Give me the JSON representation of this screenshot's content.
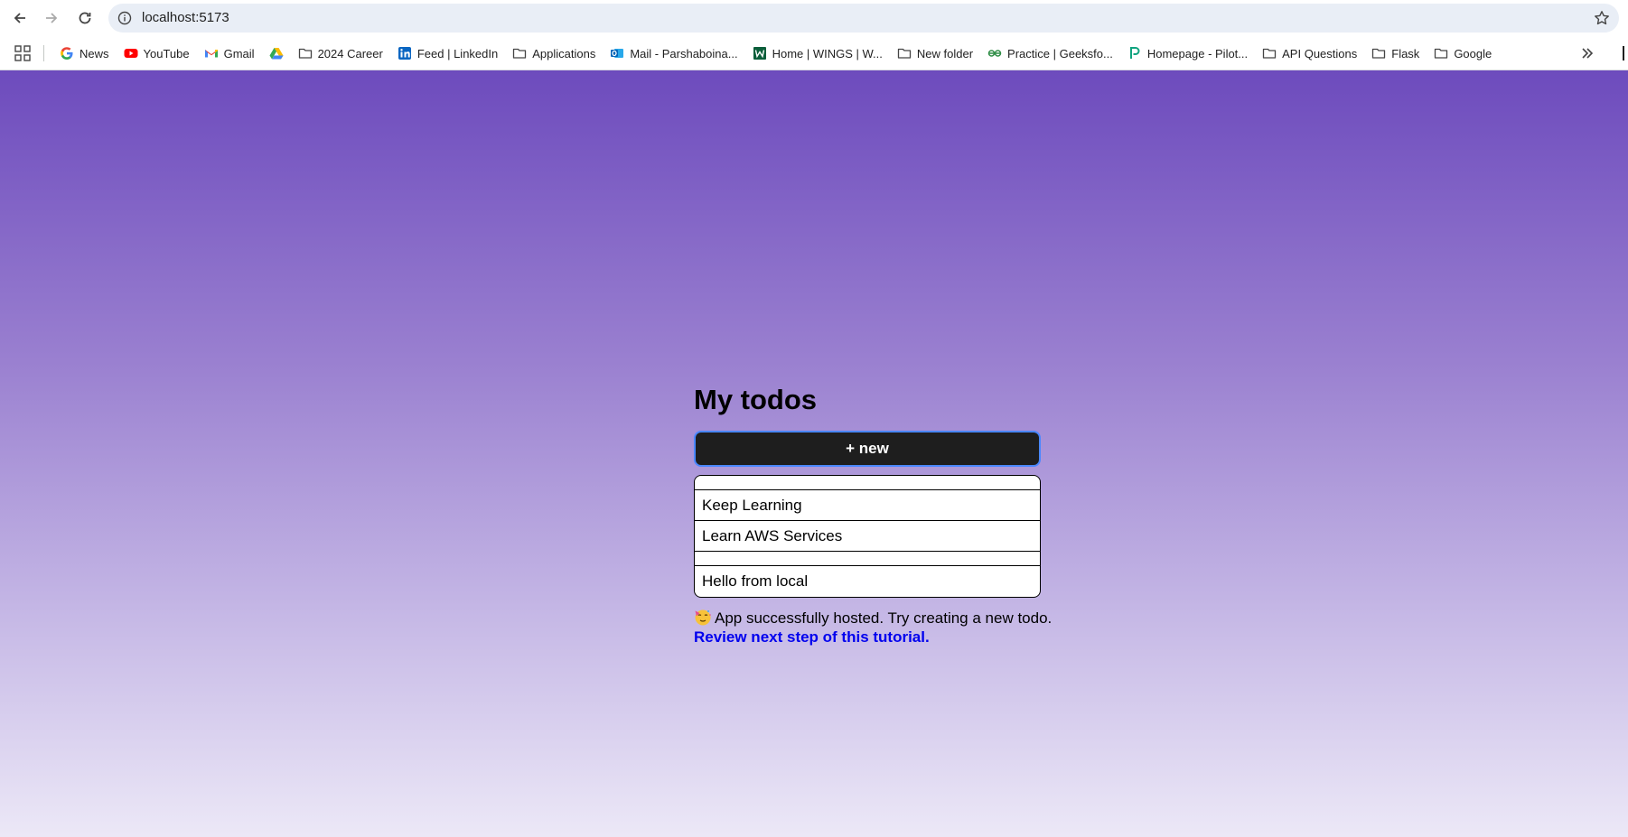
{
  "browser": {
    "url": "localhost:5173",
    "bookmarks": [
      {
        "label": "News",
        "icon": "google-icon"
      },
      {
        "label": "YouTube",
        "icon": "youtube-icon"
      },
      {
        "label": "Gmail",
        "icon": "gmail-icon"
      },
      {
        "label": "",
        "icon": "google-drive-icon"
      },
      {
        "label": "2024 Career",
        "icon": "folder-icon"
      },
      {
        "label": "Feed | LinkedIn",
        "icon": "linkedin-icon"
      },
      {
        "label": "Applications",
        "icon": "folder-icon"
      },
      {
        "label": "Mail - Parshaboina...",
        "icon": "outlook-icon"
      },
      {
        "label": "Home | WINGS | W...",
        "icon": "wings-icon"
      },
      {
        "label": "New folder",
        "icon": "folder-icon"
      },
      {
        "label": "Practice | Geeksfo...",
        "icon": "geeksforgeeks-icon"
      },
      {
        "label": "Homepage - Pilot...",
        "icon": "pilot-icon"
      },
      {
        "label": "API Questions",
        "icon": "folder-icon"
      },
      {
        "label": "Flask",
        "icon": "folder-icon"
      },
      {
        "label": "Google",
        "icon": "folder-icon"
      }
    ]
  },
  "app": {
    "title": "My todos",
    "new_button_label": "+ new",
    "todos": [
      "",
      "Keep Learning",
      "Learn AWS Services",
      "",
      "Hello from local"
    ],
    "status_emoji": "🥳",
    "status_text": "App successfully hosted. Try creating a new todo.",
    "link_text": "Review next step of this tutorial."
  },
  "colors": {
    "button_bg": "#1e1e1e",
    "button_focus_ring": "#4a87ff",
    "link": "#0000ee",
    "gradient_top": "#6d4bbd",
    "gradient_bottom": "#ece8f7"
  }
}
